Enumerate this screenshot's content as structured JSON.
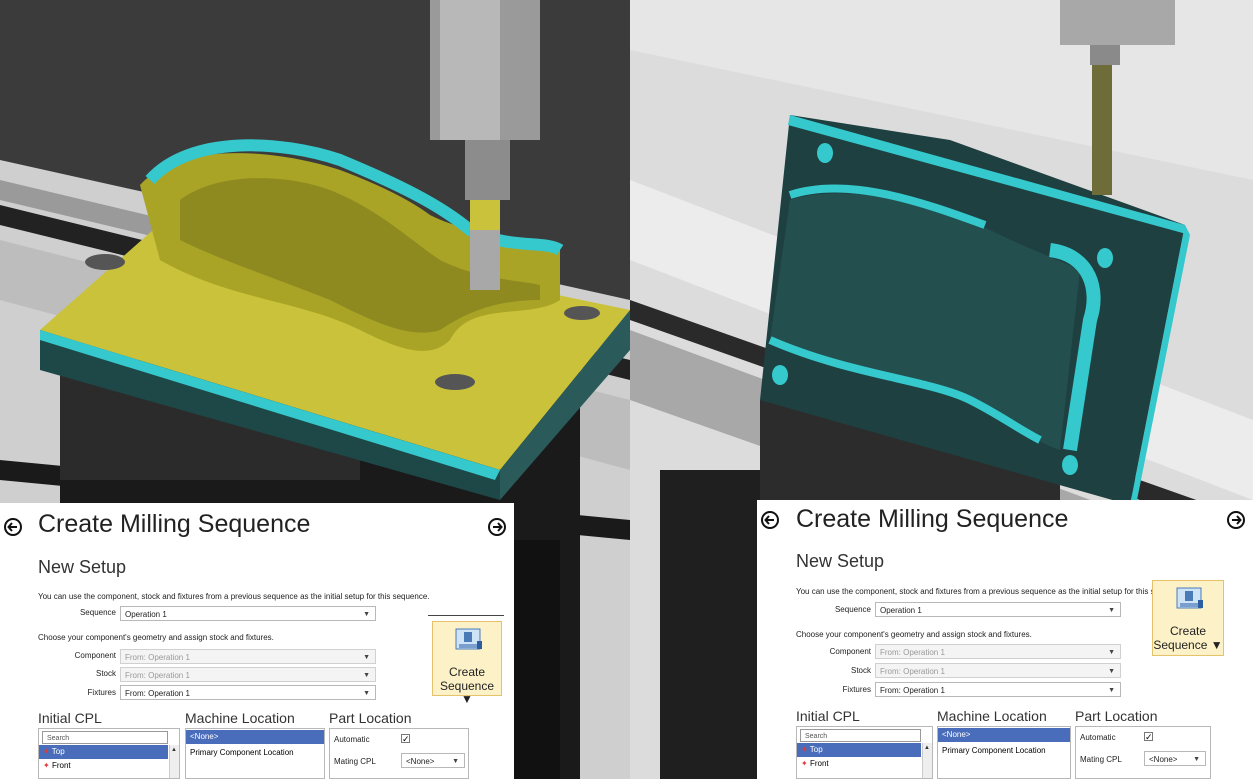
{
  "panels": [
    {
      "title": "Create Milling Sequence",
      "subtitle": "New Setup",
      "hint1": "You can use the component, stock and fixtures from a previous sequence as the initial setup for this sequence.",
      "sequence_label": "Sequence",
      "sequence_value": "Operation 1",
      "hint2": "Choose your component's geometry and assign stock and fixtures.",
      "component_label": "Component",
      "component_value": "From: Operation 1",
      "stock_label": "Stock",
      "stock_value": "From: Operation 1",
      "fixtures_label": "Fixtures",
      "fixtures_value": "From: Operation 1",
      "create_label1": "Create",
      "create_label2": "Sequence",
      "initial_cpl": "Initial CPL",
      "machine_location": "Machine Location",
      "part_location": "Part Location",
      "search_placeholder": "Search",
      "cpl_items": [
        "Top",
        "Front"
      ],
      "ml_items": [
        "<None>",
        "Primary Component Location"
      ],
      "automatic_label": "Automatic",
      "mating_label": "Mating CPL",
      "mating_value": "<None>"
    },
    {
      "title": "Create Milling Sequence",
      "subtitle": "New Setup",
      "hint1": "You can use the component, stock and fixtures from a previous sequence as the initial setup for this sec",
      "sequence_label": "Sequence",
      "sequence_value": "Operation 1",
      "hint2": "Choose your component's geometry and assign stock and fixtures.",
      "component_label": "Component",
      "component_value": "From: Operation 1",
      "stock_label": "Stock",
      "stock_value": "From: Operation 1",
      "fixtures_label": "Fixtures",
      "fixtures_value": "From: Operation 1",
      "create_label1": "Create",
      "create_label2": "Sequence",
      "initial_cpl": "Initial CPL",
      "machine_location": "Machine Location",
      "part_location": "Part Location",
      "search_placeholder": "Search",
      "cpl_items": [
        "Top",
        "Front"
      ],
      "ml_items": [
        "<None>",
        "Primary Component Location"
      ],
      "automatic_label": "Automatic",
      "mating_label": "Mating CPL",
      "mating_value": "<None>"
    }
  ],
  "colors": {
    "part_cyan": "#35c8cc",
    "part_yellow": "#c9c23a",
    "dark_part": "#1e4040",
    "selection": "#4a6dbb",
    "button_bg": "#fdf2c7"
  },
  "icons": [
    "back-arrow-icon",
    "forward-arrow-icon",
    "machine-icon",
    "cpl-axis-icon",
    "dropdown-arrow-icon"
  ]
}
